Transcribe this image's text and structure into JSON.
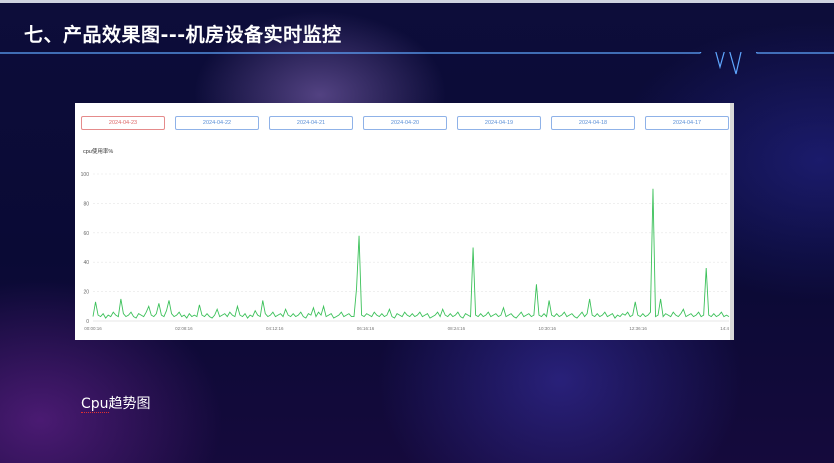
{
  "slide": {
    "title": "七、产品效果图---机房设备实时监控",
    "caption_prefix": "Cpu",
    "caption_suffix": "趋势图"
  },
  "tabs": [
    {
      "label": "2024-04-23",
      "active": true
    },
    {
      "label": "2024-04-22",
      "active": false
    },
    {
      "label": "2024-04-21",
      "active": false
    },
    {
      "label": "2024-04-20",
      "active": false
    },
    {
      "label": "2024-04-19",
      "active": false
    },
    {
      "label": "2024-04-18",
      "active": false
    },
    {
      "label": "2024-04-17",
      "active": false
    }
  ],
  "colors": {
    "line": "#3cc15a",
    "grid": "#e6e6e6",
    "active_tab": "#e58b8b",
    "tab": "#8fb2e8"
  },
  "chart_data": {
    "type": "line",
    "title": "cpu使用率%",
    "ylim": [
      0,
      100
    ],
    "yticks": [
      0,
      20,
      40,
      60,
      80,
      100
    ],
    "xtick_labels": [
      "00:00:16",
      "02:08:16",
      "04:12:16",
      "06:16:16",
      "08:24:16",
      "10:30:16",
      "12:36:16",
      "14:4"
    ],
    "grid": true,
    "series": [
      {
        "values": [
          3,
          13,
          4,
          3,
          5,
          2,
          4,
          3,
          6,
          4,
          3,
          15,
          5,
          3,
          4,
          6,
          3,
          2,
          5,
          4,
          3,
          6,
          10,
          4,
          3,
          5,
          12,
          4,
          3,
          7,
          14,
          5,
          3,
          4,
          6,
          3,
          4,
          2,
          5,
          3,
          4,
          3,
          11,
          4,
          3,
          5,
          3,
          2,
          4,
          8,
          3,
          4,
          5,
          3,
          6,
          4,
          3,
          10,
          4,
          3,
          5,
          2,
          4,
          3,
          7,
          4,
          3,
          14,
          5,
          3,
          4,
          6,
          3,
          4,
          5,
          3,
          8,
          4,
          3,
          5,
          3,
          4,
          6,
          3,
          2,
          5,
          4,
          9,
          3,
          6,
          4,
          10,
          3,
          4,
          5,
          2,
          3,
          4,
          6,
          3,
          4,
          5,
          3,
          3,
          22,
          58,
          4,
          3,
          5,
          4,
          3,
          6,
          4,
          3,
          5,
          3,
          4,
          8,
          3,
          2,
          5,
          4,
          3,
          6,
          4,
          3,
          5,
          3,
          4,
          6,
          3,
          4,
          5,
          2,
          3,
          4,
          6,
          3,
          8,
          4,
          3,
          5,
          3,
          4,
          6,
          3,
          2,
          5,
          4,
          3,
          50,
          4,
          3,
          5,
          3,
          4,
          6,
          3,
          4,
          5,
          3,
          4,
          9,
          3,
          4,
          5,
          3,
          2,
          4,
          6,
          3,
          4,
          5,
          3,
          4,
          25,
          4,
          3,
          5,
          3,
          14,
          4,
          3,
          5,
          3,
          4,
          6,
          3,
          4,
          5,
          3,
          2,
          4,
          6,
          3,
          5,
          15,
          4,
          3,
          5,
          3,
          4,
          6,
          3,
          4,
          5,
          2,
          4,
          3,
          5,
          4,
          6,
          3,
          4,
          13,
          4,
          3,
          5,
          3,
          4,
          6,
          90,
          3,
          4,
          15,
          3,
          5,
          4,
          3,
          6,
          4,
          3,
          5,
          8,
          3,
          4,
          5,
          3,
          4,
          6,
          3,
          4,
          36,
          4,
          3,
          5,
          3,
          4,
          6,
          3,
          4,
          3
        ]
      }
    ]
  }
}
